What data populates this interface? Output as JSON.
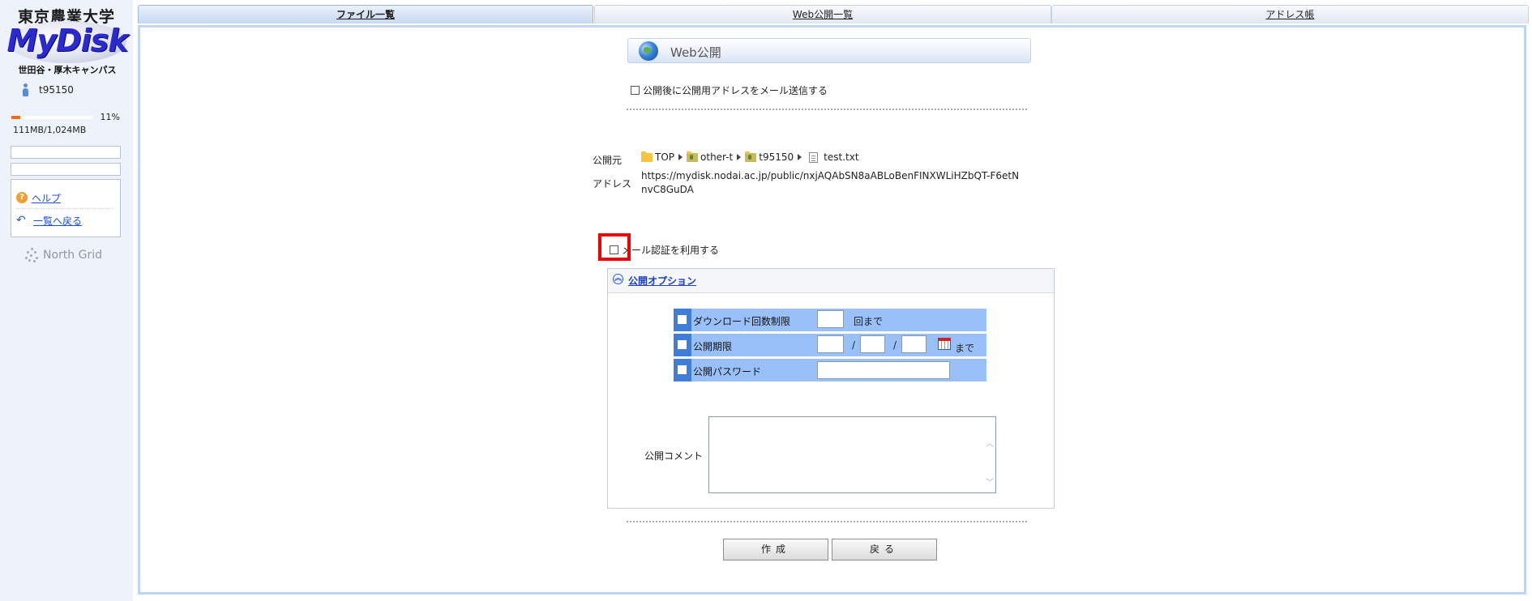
{
  "sidebar": {
    "logo": {
      "jp_title": "東京農業大学",
      "main": "MyDisk",
      "campus": "世田谷・厚木キャンパス"
    },
    "user": "t95150",
    "quota": {
      "percent_label": "11%",
      "percent": 11,
      "size": "111MB/1,024MB"
    },
    "links": {
      "help": "ヘルプ",
      "back_to_list": "一覧へ戻る"
    },
    "brand": "North Grid"
  },
  "tabs": [
    {
      "label": "ファイル一覧",
      "active": true
    },
    {
      "label": "Web公開一覧",
      "active": false
    },
    {
      "label": "アドレス帳",
      "active": false
    }
  ],
  "main": {
    "title": "Web公開",
    "send_mail_label": "公開後に公開用アドレスをメール送信する",
    "source_label": "公開元",
    "address_label": "アドレス",
    "breadcrumb": [
      "TOP",
      "other-t",
      "t95150",
      "test.txt"
    ],
    "address": "https://mydisk.nodai.ac.jp/public/nxjAQAbSN8aABLoBenFINXWLiHZbQT-F6etNnvC8GuDA",
    "mail_auth_label": "メール認証を利用する",
    "options": {
      "header": "公開オプション",
      "download_limit": {
        "label": "ダウンロード回数制限",
        "suffix": "回まで"
      },
      "expiry": {
        "label": "公開期限",
        "sep": "/",
        "suffix": "まで"
      },
      "password": {
        "label": "公開パスワード"
      }
    },
    "comment_label": "公開コメント",
    "buttons": {
      "create": "作成",
      "back": "戻る"
    }
  },
  "colors": {
    "accent": "#3e7ed9",
    "option_row": "#99c0f9",
    "highlight": "#ee0000",
    "quota_fill": "#f06a1a"
  },
  "icons": [
    "user-icon",
    "help-icon",
    "back-arrow-icon",
    "globe-icon",
    "folder-icon",
    "file-icon",
    "calendar-icon",
    "collapse-icon"
  ]
}
